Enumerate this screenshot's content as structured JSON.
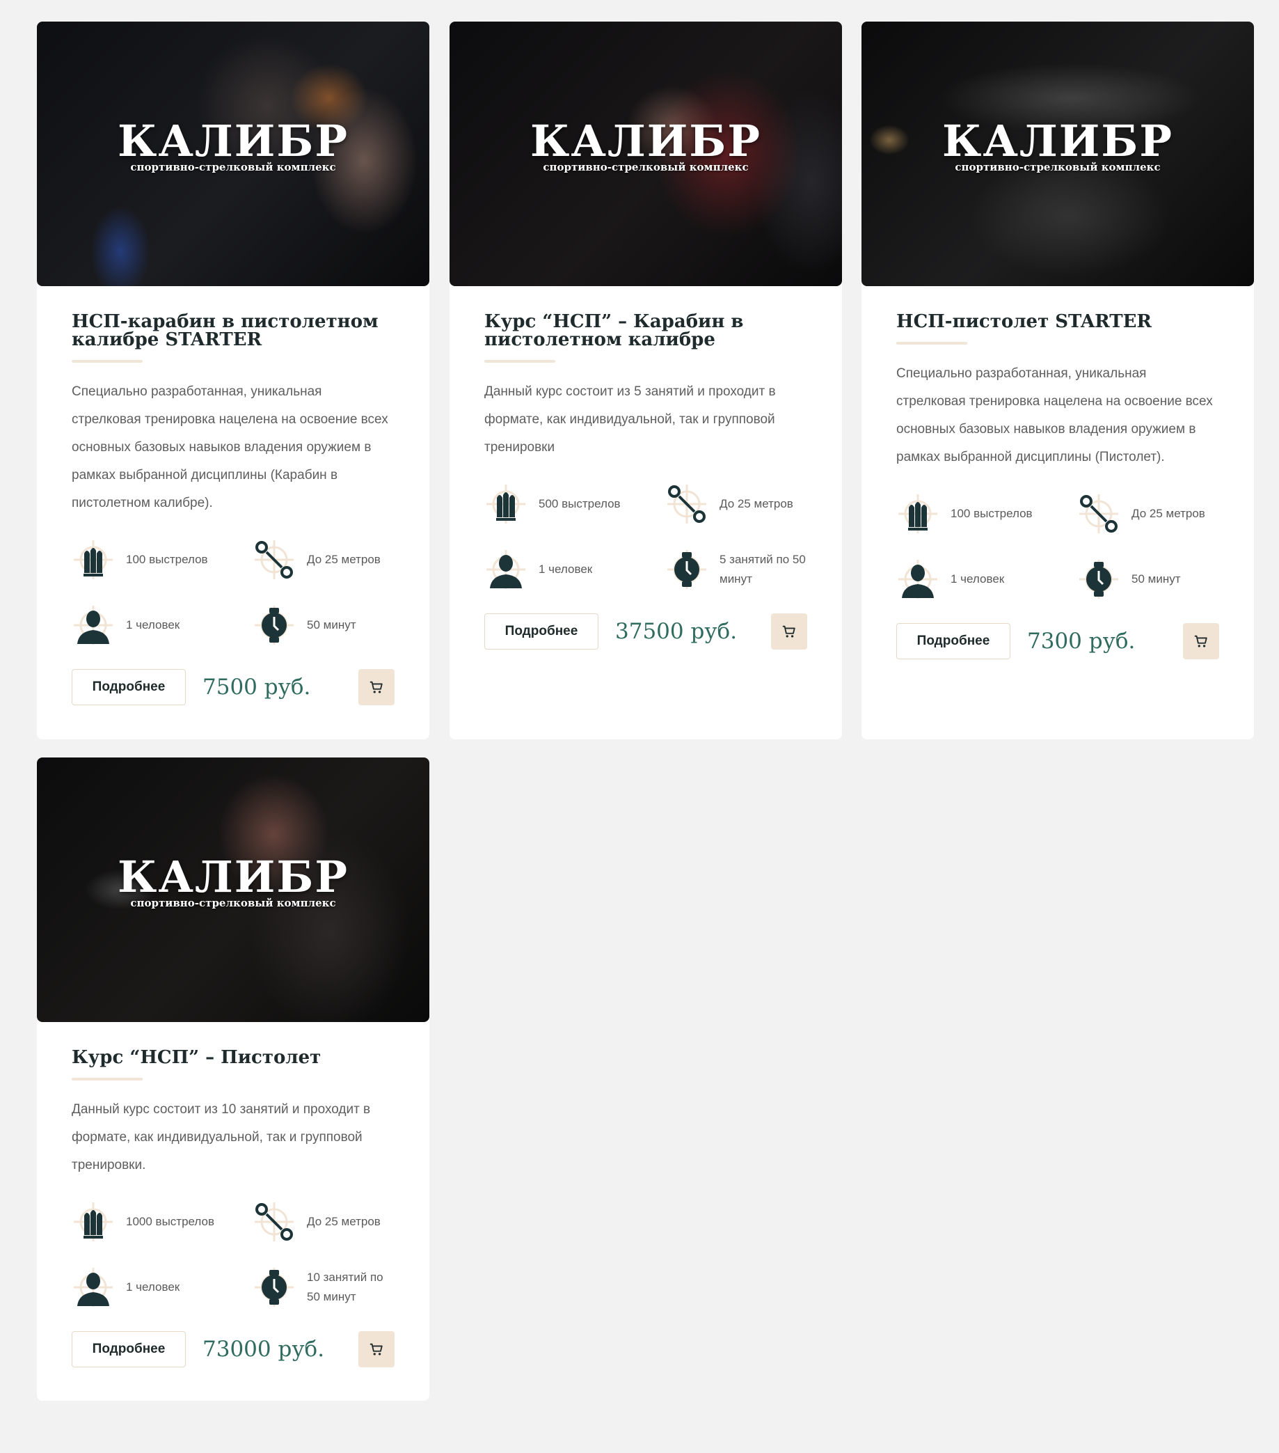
{
  "brand": {
    "logo": "КАЛИБР",
    "tagline": "спортивно-стрелковый комплекс"
  },
  "colors": {
    "accent": "#f1e4d5",
    "price": "#2f6b5e",
    "title": "#1e2a2c",
    "icon": "#1c3437"
  },
  "cards": [
    {
      "title": "НСП-карабин в пистолетном калибре STARTER",
      "description": "Специально разработанная, уникальная стрелковая тренировка нацелена на освоение всех основных базовых навыков владения оружием в рамках выбранной дисциплины (Карабин в пистолетном калибре).",
      "features": [
        {
          "icon": "bullets-icon",
          "text": "100 выстрелов"
        },
        {
          "icon": "distance-icon",
          "text": "До 25 метров"
        },
        {
          "icon": "person-icon",
          "text": "1 человек"
        },
        {
          "icon": "stopwatch-icon",
          "text": "50 минут"
        }
      ],
      "button": "Подробнее",
      "price": "7500 руб."
    },
    {
      "title": "Курс “НСП” – Карабин в пистолетном калибре",
      "description": "Данный курс состоит из 5 занятий и проходит в формате, как индивидуальной, так и групповой тренировки",
      "features": [
        {
          "icon": "bullets-icon",
          "text": "500 выстрелов"
        },
        {
          "icon": "distance-icon",
          "text": "До 25 метров"
        },
        {
          "icon": "person-icon",
          "text": "1 человек"
        },
        {
          "icon": "stopwatch-icon",
          "text": "5 занятий по 50 минут"
        }
      ],
      "button": "Подробнее",
      "price": "37500 руб."
    },
    {
      "title": "НСП-пистолет STARTER",
      "description": "Специально разработанная, уникальная стрелковая тренировка нацелена на освоение всех основных базовых навыков владения оружием в рамках выбранной дисциплины (Пистолет).",
      "features": [
        {
          "icon": "bullets-icon",
          "text": "100 выстрелов"
        },
        {
          "icon": "distance-icon",
          "text": "До 25 метров"
        },
        {
          "icon": "person-icon",
          "text": "1 человек"
        },
        {
          "icon": "stopwatch-icon",
          "text": "50 минут"
        }
      ],
      "button": "Подробнее",
      "price": "7300 руб."
    },
    {
      "title": "Курс “НСП” – Пистолет",
      "description": "Данный курс состоит из 10 занятий и проходит в формате, как индивидуальной, так и групповой тренировки.",
      "features": [
        {
          "icon": "bullets-icon",
          "text": "1000 выстрелов"
        },
        {
          "icon": "distance-icon",
          "text": "До 25 метров"
        },
        {
          "icon": "person-icon",
          "text": "1 человек"
        },
        {
          "icon": "stopwatch-icon",
          "text": "10 занятий по 50 минут"
        }
      ],
      "button": "Подробнее",
      "price": "73000 руб."
    }
  ]
}
